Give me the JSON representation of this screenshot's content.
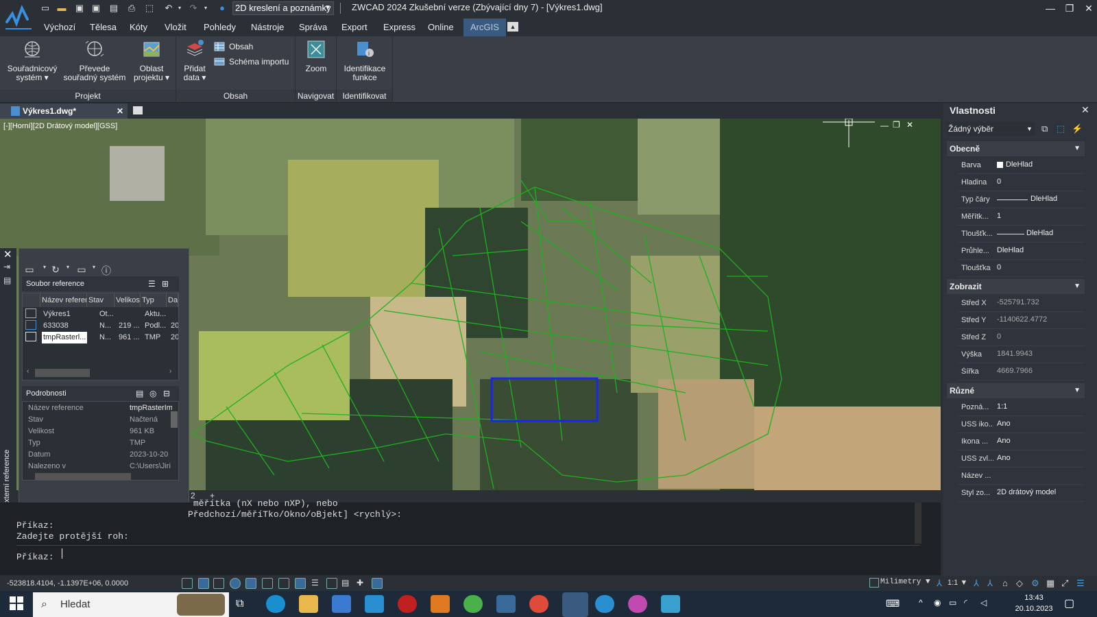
{
  "titlebar": {
    "workspace": "2D kreslení a poznámky",
    "title": "ZWCAD 2024 Zkušební verze (Zbývající dny 7) - [Výkres1.dwg]"
  },
  "menu": [
    "Výchozí",
    "Tělesa",
    "Kóty",
    "Vložit",
    "Pohledy",
    "Nástroje",
    "Správa",
    "Export",
    "Express",
    "Online",
    "ArcGIS"
  ],
  "ribbon": {
    "btn_coord": [
      "Souřadnicový",
      "systém ▾"
    ],
    "btn_convert": [
      "Převede",
      "souřadný systém"
    ],
    "btn_area": [
      "Oblast",
      "projektu ▾"
    ],
    "btn_add": [
      "Přidat",
      "data ▾"
    ],
    "btn_content": "Obsah",
    "btn_schema": "Schéma importu",
    "btn_zoom": "Zoom",
    "btn_identify": [
      "Identifikace",
      "funkce"
    ],
    "panels": [
      "Projekt",
      "Obsah",
      "Navigovat",
      "Identifikovat"
    ]
  },
  "doc": {
    "tab": "Výkres1.dwg*",
    "viewport_label": "[-][Horní][2D Drátový model][GSS]",
    "layout_tab": "2",
    "add_tab": "+"
  },
  "xref": {
    "side_label": "Externí reference",
    "files_title": "Soubor reference",
    "columns": [
      "Název referen",
      "Stav",
      "Velikost",
      "Typ",
      "Da"
    ],
    "rows": [
      {
        "name": "Výkres1",
        "state": "Ot...",
        "size": "",
        "type": "Aktu...",
        "date": ""
      },
      {
        "name": "633038",
        "state": "N...",
        "size": "219 ...",
        "type": "Podl...",
        "date": "20"
      },
      {
        "name": "tmpRasterl...",
        "state": "N...",
        "size": "961 ...",
        "type": "TMP",
        "date": "20"
      }
    ],
    "details_title": "Podrobnosti",
    "details": [
      {
        "k": "Název reference",
        "v": "tmpRasterIm"
      },
      {
        "k": "Stav",
        "v": "Načtená"
      },
      {
        "k": "Velikost",
        "v": "961 KB"
      },
      {
        "k": "Typ",
        "v": "TMP"
      },
      {
        "k": "Datum",
        "v": "2023-10-20"
      },
      {
        "k": "Nalezeno v",
        "v": "C:\\Users\\Jiri"
      }
    ]
  },
  "command": {
    "l1": "měřítka (nX nebo nXP), nebo",
    "l2": "Předchozí/měříTko/Okno/oBjekt] <rychlý>:",
    "l3": "Příkaz:",
    "l4": "Zadejte protější roh:",
    "prompt": "Příkaz:"
  },
  "status": {
    "coords": "-523818.4104, -1.1397E+06, 0.0000",
    "units": "Milimetry",
    "scale": "1:1"
  },
  "props": {
    "title": "Vlastnosti",
    "selection": "Žádný výběr",
    "groups": [
      "Obecně",
      "Zobrazit",
      "Různé"
    ],
    "general": [
      {
        "k": "Barva",
        "v": "DleHlad"
      },
      {
        "k": "Hladina",
        "v": "0"
      },
      {
        "k": "Typ čáry",
        "v": "DleHlad"
      },
      {
        "k": "Měřítk...",
        "v": "1"
      },
      {
        "k": "Tloušťk...",
        "v": "DleHlad"
      },
      {
        "k": "Průhle...",
        "v": "DleHlad"
      },
      {
        "k": "Tloušťka",
        "v": "0"
      }
    ],
    "display": [
      {
        "k": "Střed X",
        "v": "-525791.732"
      },
      {
        "k": "Střed Y",
        "v": "-1140622.4772"
      },
      {
        "k": "Střed Z",
        "v": "0"
      },
      {
        "k": "Výška",
        "v": "1841.9943"
      },
      {
        "k": "Šířka",
        "v": "4669.7966"
      }
    ],
    "misc": [
      {
        "k": "Pozná...",
        "v": "1:1"
      },
      {
        "k": "USS iko...",
        "v": "Ano"
      },
      {
        "k": "Ikona ...",
        "v": "Ano"
      },
      {
        "k": "USS zvl...",
        "v": "Ano"
      },
      {
        "k": "Název ...",
        "v": ""
      },
      {
        "k": "Styl zo...",
        "v": "2D drátový model"
      }
    ]
  },
  "taskbar": {
    "search": "Hledat",
    "time": "13:43",
    "date": "20.10.2023"
  }
}
